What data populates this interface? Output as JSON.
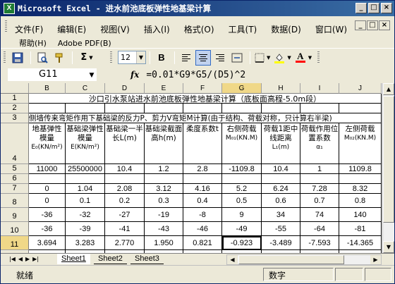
{
  "window": {
    "title": "Microsoft Excel - 进水前池底板弹性地基梁计算",
    "app_icon_letter": "X",
    "min_glyph": "_",
    "max_glyph": "□",
    "close_glyph": "×"
  },
  "menu": {
    "items": [
      "文件(F)",
      "编辑(E)",
      "视图(V)",
      "插入(I)",
      "格式(O)",
      "工具(T)",
      "数据(D)",
      "窗口(W)"
    ],
    "row2": [
      "帮助(H)",
      "Adobe PDF(B)"
    ]
  },
  "toolbar": {
    "font_size": "12",
    "bold_label": "B",
    "sigma_label": "Σ",
    "font_color_label": "A"
  },
  "formula_bar": {
    "cell_ref": "G11",
    "fx_label": "fx",
    "formula": "=0.01*G9*G5/(D5)^2"
  },
  "colors": {
    "title_gradient_start": "#0a246a",
    "selection_header": "#f0d888",
    "chrome": "#ece9d8"
  },
  "columns": [
    "B",
    "C",
    "D",
    "E",
    "F",
    "G",
    "H",
    "I",
    "J"
  ],
  "rows": [
    "1",
    "2",
    "3",
    "4",
    "5",
    "6",
    "7",
    "8",
    "9",
    "10",
    "11",
    "12"
  ],
  "sheet": {
    "title": "沙口引水泵站进水前池底板弹性地基梁计算（底板面高程-5.0m段）",
    "subtitle": "侧墙传来弯矩作用下基础梁的反力P、剪力V弯矩M计算(由于结构、荷载对称，只计算右半梁)",
    "headers": [
      {
        "main": "地基弹性模量",
        "unit": "E₀(KN/m²)"
      },
      {
        "main": "基础梁弹性模量",
        "unit": "E(KN/m²)"
      },
      {
        "main": "基础梁一半长L(m)",
        "unit": ""
      },
      {
        "main": "基础梁截面高h(m)",
        "unit": ""
      },
      {
        "main": "柔度系数t",
        "unit": ""
      },
      {
        "main": "右侧荷载",
        "unit": "M₀₁(KN.M)"
      },
      {
        "main": "荷载1距中线距离",
        "unit": "L₁(m)"
      },
      {
        "main": "荷载作用位置系数",
        "unit": "α₁"
      },
      {
        "main": "左侧荷载",
        "unit": "M₀₂(KN.M)"
      }
    ],
    "row5": [
      "11000",
      "25500000",
      "10.4",
      "1.2",
      "2.8",
      "-1109.8",
      "10.4",
      "1",
      "1109.8"
    ],
    "row7": [
      "0",
      "1.04",
      "2.08",
      "3.12",
      "4.16",
      "5.2",
      "6.24",
      "7.28",
      "8.32"
    ],
    "row8": [
      "0",
      "0.1",
      "0.2",
      "0.3",
      "0.4",
      "0.5",
      "0.6",
      "0.7",
      "0.8"
    ],
    "row9": [
      "-36",
      "-32",
      "-27",
      "-19",
      "-8",
      "9",
      "34",
      "74",
      "140"
    ],
    "row10": [
      "-36",
      "-39",
      "-41",
      "-43",
      "-46",
      "-49",
      "-55",
      "-64",
      "-81"
    ],
    "row11": [
      "3.694",
      "3.283",
      "2.770",
      "1.950",
      "0.821",
      "-0.923",
      "-3.489",
      "-7.593",
      "-14.365"
    ],
    "row12": [
      "3.694",
      "4.002",
      "4.207",
      "4.412",
      "4.720",
      "5.028",
      "5.643",
      "6.567",
      "8.311"
    ]
  },
  "tabs": [
    "Sheet1",
    "Sheet2",
    "Sheet3"
  ],
  "active_tab": "Sheet1",
  "status": {
    "ready": "就绪",
    "mode": "数字"
  }
}
